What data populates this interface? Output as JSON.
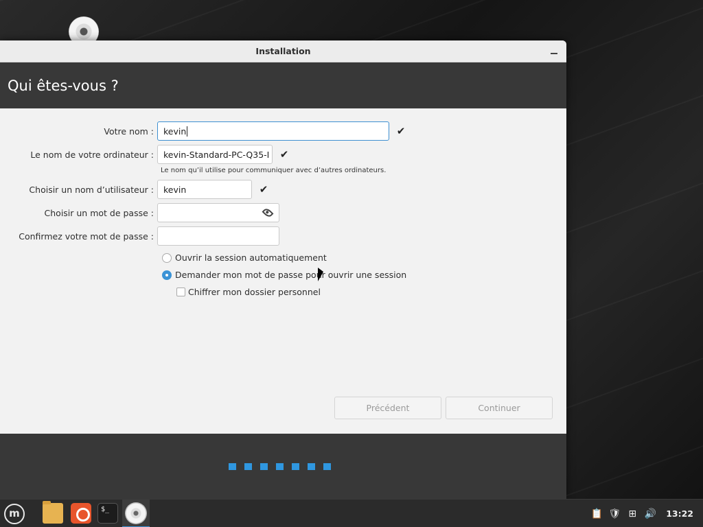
{
  "window": {
    "title": "Installation",
    "heading": "Qui êtes-vous ?"
  },
  "form": {
    "name": {
      "label": "Votre nom :",
      "value": "kevin",
      "valid": true
    },
    "computer": {
      "label": "Le nom de votre ordinateur :",
      "value": "kevin-Standard-PC-Q35-I",
      "valid": true,
      "hint": "Le nom qu’il utilise pour communiquer avec d’autres ordinateurs."
    },
    "username": {
      "label": "Choisir un nom d’utilisateur :",
      "value": "kevin",
      "valid": true
    },
    "password": {
      "label": "Choisir un mot de passe :",
      "value": ""
    },
    "confirm": {
      "label": "Confirmez votre mot de passe :",
      "value": ""
    },
    "options": {
      "auto_login": {
        "label": "Ouvrir la session automatiquement",
        "checked": false
      },
      "ask_password": {
        "label": "Demander mon mot de passe pour ouvrir une session",
        "checked": true
      },
      "encrypt_home": {
        "label": "Chiffrer mon dossier personnel",
        "checked": false
      }
    }
  },
  "buttons": {
    "previous": "Précédent",
    "continue": "Continuer"
  },
  "progress": {
    "steps": 7
  },
  "taskbar": {
    "launchers": [
      "mint-menu-icon",
      "files-icon",
      "firefox-icon",
      "terminal-icon",
      "installer-icon"
    ],
    "terminal_glyph": "$_",
    "clock": "13:22",
    "tray": [
      "clipboard-icon",
      "shield-icon",
      "network-icon",
      "volume-icon"
    ]
  },
  "colors": {
    "accent": "#3b93d6",
    "header_bg": "#383838"
  }
}
